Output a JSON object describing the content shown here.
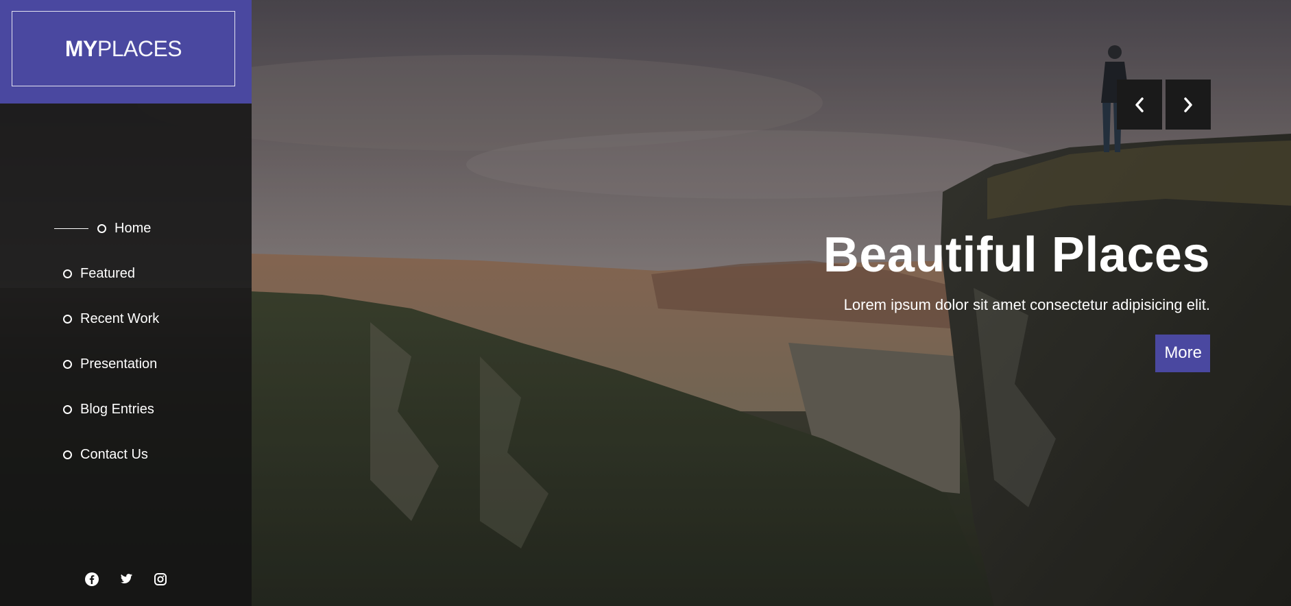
{
  "brand": {
    "logo_bold": "MY",
    "logo_light": "PLACES",
    "accent_color": "#4a48a0"
  },
  "sidebar": {
    "nav": [
      {
        "label": "Home",
        "active": true
      },
      {
        "label": "Featured",
        "active": false
      },
      {
        "label": "Recent Work",
        "active": false
      },
      {
        "label": "Presentation",
        "active": false
      },
      {
        "label": "Blog Entries",
        "active": false
      },
      {
        "label": "Contact Us",
        "active": false
      }
    ],
    "social": [
      {
        "icon": "facebook-icon"
      },
      {
        "icon": "twitter-icon"
      },
      {
        "icon": "instagram-icon"
      }
    ]
  },
  "slider": {
    "prev_icon": "chevron-left-icon",
    "next_icon": "chevron-right-icon"
  },
  "hero": {
    "title": "Beautiful Places",
    "subtitle": "Lorem ipsum dolor sit amet consectetur adipisicing elit.",
    "button_label": "More"
  }
}
